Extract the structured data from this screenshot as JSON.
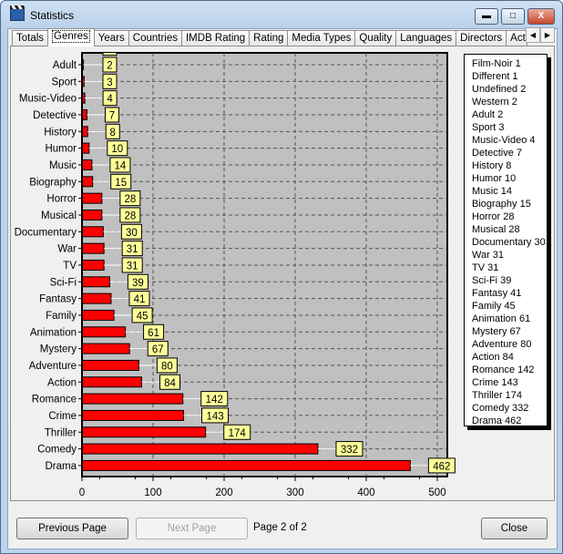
{
  "window": {
    "title": "Statistics",
    "minimize": "▬",
    "maximize": "□",
    "close": "X"
  },
  "tabs": [
    "Totals",
    "Genres",
    "Years",
    "Countries",
    "IMDB Rating",
    "Rating",
    "Media Types",
    "Quality",
    "Languages",
    "Directors",
    "Actors"
  ],
  "active_tab": "Genres",
  "buttons": {
    "previous": "Previous Page",
    "next": "Next Page",
    "close": "Close"
  },
  "page_label": "Page 2 of 2",
  "chart_data": {
    "type": "bar",
    "orientation": "horizontal",
    "title": "",
    "xlabel": "",
    "ylabel": "",
    "xlim": [
      0,
      500
    ],
    "xticks": [
      0,
      100,
      200,
      300,
      400,
      500
    ],
    "grid": true,
    "legend": "right",
    "categories": [
      "Film-Noir",
      "Different",
      "Undefined",
      "Western",
      "Adult",
      "Sport",
      "Music-Video",
      "Detective",
      "History",
      "Humor",
      "Music",
      "Biography",
      "Horror",
      "Musical",
      "Documentary",
      "War",
      "TV",
      "Sci-Fi",
      "Fantasy",
      "Family",
      "Animation",
      "Mystery",
      "Adventure",
      "Action",
      "Romance",
      "Crime",
      "Thriller",
      "Comedy",
      "Drama"
    ],
    "values": [
      1,
      1,
      2,
      2,
      2,
      3,
      4,
      7,
      8,
      10,
      14,
      15,
      28,
      28,
      30,
      31,
      31,
      39,
      41,
      45,
      61,
      67,
      80,
      84,
      142,
      143,
      174,
      332,
      462
    ],
    "bar_color": "#ff0000",
    "label_bg": "#ffff99",
    "plot_bg": "#c0c0c0"
  }
}
